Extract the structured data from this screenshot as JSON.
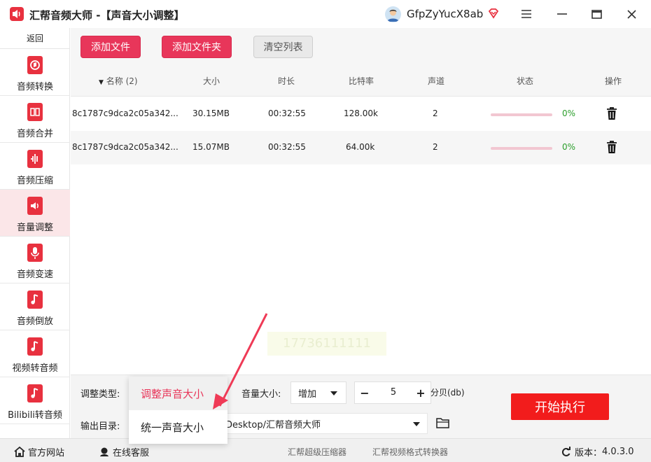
{
  "app": {
    "title": "汇帮音频大师  -【声音大小调整】",
    "username": "GfpZyYucX8ab"
  },
  "sidebar": {
    "back_label": "返回",
    "items": [
      {
        "label": "音频转换",
        "icon": "audio-convert-icon"
      },
      {
        "label": "音频合并",
        "icon": "audio-merge-icon"
      },
      {
        "label": "音频压缩",
        "icon": "audio-compress-icon"
      },
      {
        "label": "音量调整",
        "icon": "volume-icon"
      },
      {
        "label": "音频变速",
        "icon": "microphone-icon"
      },
      {
        "label": "音频倒放",
        "icon": "music-note-icon"
      },
      {
        "label": "视频转音频",
        "icon": "music-note-icon"
      },
      {
        "label": "Bilibili转音频",
        "icon": "music-note-icon"
      }
    ]
  },
  "toolbar": {
    "add_file": "添加文件",
    "add_folder": "添加文件夹",
    "clear_list": "清空列表"
  },
  "table": {
    "columns": {
      "name": "名称 (2)",
      "size": "大小",
      "duration": "时长",
      "bitrate": "比特率",
      "channels": "声道",
      "status": "状态",
      "actions": "操作"
    },
    "rows": [
      {
        "name": "8c1787c9dca2c05a342...",
        "size": "30.15MB",
        "duration": "00:32:55",
        "bitrate": "128.00k",
        "channels": "2",
        "progress_pct": "0%",
        "progress": 0
      },
      {
        "name": "8c1787c9dca2c05a342...",
        "size": "15.07MB",
        "duration": "00:32:55",
        "bitrate": "64.00k",
        "channels": "2",
        "progress_pct": "0%",
        "progress": 0
      }
    ]
  },
  "watermark": "17736111111",
  "settings": {
    "adjust_type_label": "调整类型:",
    "volume_label": "音量大小:",
    "volume_mode": "增加",
    "volume_value": "5",
    "volume_unit": "分贝(db)",
    "output_dir_label": "输出目录:",
    "output_dir_value": "Desktop/汇帮音频大师",
    "start_button": "开始执行",
    "dropdown_options": [
      "调整声音大小",
      "统一声音大小"
    ]
  },
  "footer": {
    "website": "官方网站",
    "support": "在线客服",
    "link1": "汇帮超级压缩器",
    "link2": "汇帮视频格式转换器",
    "version_label": "版本：",
    "version": "4.0.3.0"
  },
  "colors": {
    "accent": "#e8365a",
    "start": "#f21c1c",
    "success": "#2b9e2b"
  }
}
